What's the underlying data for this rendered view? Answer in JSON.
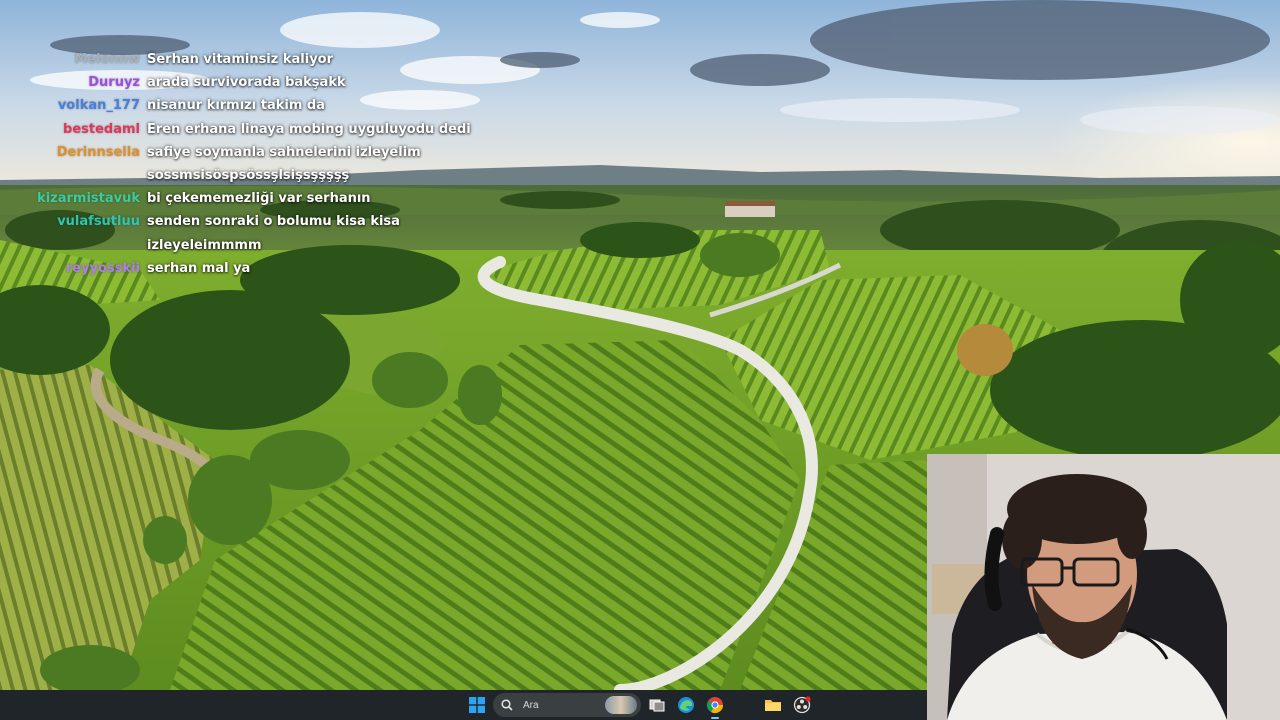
{
  "chat": {
    "messages": [
      {
        "user": "Melonnw",
        "text": "Serhan vitaminsiz kaliyor",
        "color": "#a9b0b8"
      },
      {
        "user": "Duruyz",
        "text": "arada survivorada bakşakk",
        "color": "#9b4fe0"
      },
      {
        "user": "volkan_177",
        "text": "nisanur kırmızı takim da",
        "color": "#4a7fd8"
      },
      {
        "user": "bestedaml",
        "text": "Eren erhana linaya mobing uyguluyodu dedi",
        "color": "#e0365a"
      },
      {
        "user": "Derinnsella",
        "text": "safiye soymanla sahnelerini izleyelim",
        "color": "#e0902a"
      },
      {
        "user": "",
        "text": "sossmsisöspsössşlsişsşşşşş",
        "color": "#ffffff"
      },
      {
        "user": "kizarmistavuk",
        "text": "bi çekememezliği var serhanın",
        "color": "#3ec9a0"
      },
      {
        "user": "vulafsutluu",
        "text": "senden sonraki o bolumu kisa kisa",
        "color": "#2fc6b0"
      },
      {
        "user": "",
        "text": "izleyeleimmmm",
        "color": "#ffffff"
      },
      {
        "user": "reyyosskii",
        "text": "serhan mal ya",
        "color": "#b07cf0"
      }
    ]
  },
  "taskbar": {
    "search_placeholder": "Ara",
    "apps": [
      {
        "name": "windows-start",
        "icon": "windows-logo-icon"
      },
      {
        "name": "task-view",
        "icon": "task-view-icon"
      },
      {
        "name": "edge",
        "icon": "edge-browser-icon"
      },
      {
        "name": "chrome",
        "icon": "chrome-browser-icon",
        "active": true
      },
      {
        "name": "file-explorer",
        "icon": "folder-icon"
      },
      {
        "name": "obs",
        "icon": "obs-record-icon"
      }
    ]
  },
  "colors": {
    "taskbar_bg": "#1f2528",
    "accent": "#7ec4f5"
  }
}
